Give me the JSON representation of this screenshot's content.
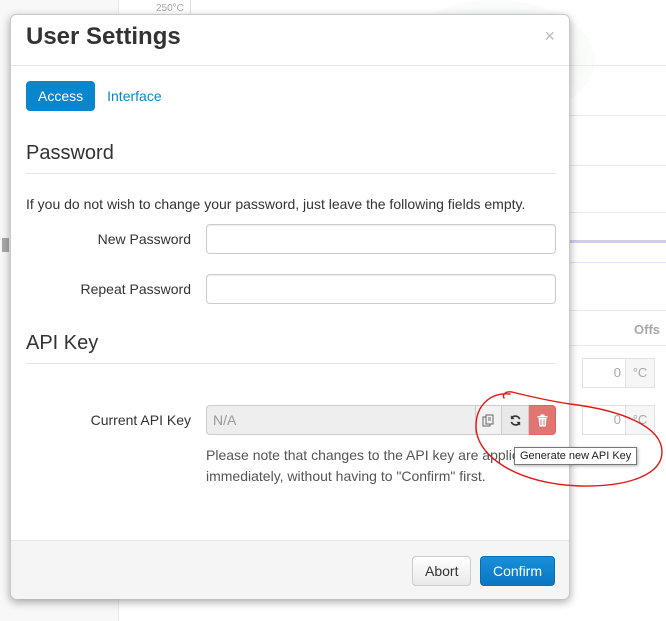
{
  "background": {
    "temp_label": "250°C",
    "offset_header": "Offs",
    "offset_rows": [
      {
        "value": "0",
        "unit": "°C"
      },
      {
        "value": "0",
        "unit": "°C"
      }
    ]
  },
  "modal": {
    "title": "User Settings",
    "close_glyph": "×",
    "tabs": [
      {
        "label": "Access",
        "active": true
      },
      {
        "label": "Interface",
        "active": false
      }
    ],
    "password": {
      "heading": "Password",
      "help": "If you do not wish to change your password, just leave the following fields empty.",
      "new_password_label": "New Password",
      "new_password_value": "",
      "repeat_password_label": "Repeat Password",
      "repeat_password_value": ""
    },
    "api": {
      "heading": "API Key",
      "current_label": "Current API Key",
      "current_value": "N/A",
      "note": "Please note that changes to the API key are applied immediately, without having to \"Confirm\" first.",
      "copy_icon": "copy-icon",
      "refresh_icon": "refresh-icon",
      "delete_icon": "trash-icon",
      "refresh_tooltip": "Generate new API Key"
    },
    "footer": {
      "abort_label": "Abort",
      "confirm_label": "Confirm"
    }
  },
  "colors": {
    "primary": "#0a86cf",
    "danger": "#d9534f",
    "annotation": "#e01818"
  }
}
